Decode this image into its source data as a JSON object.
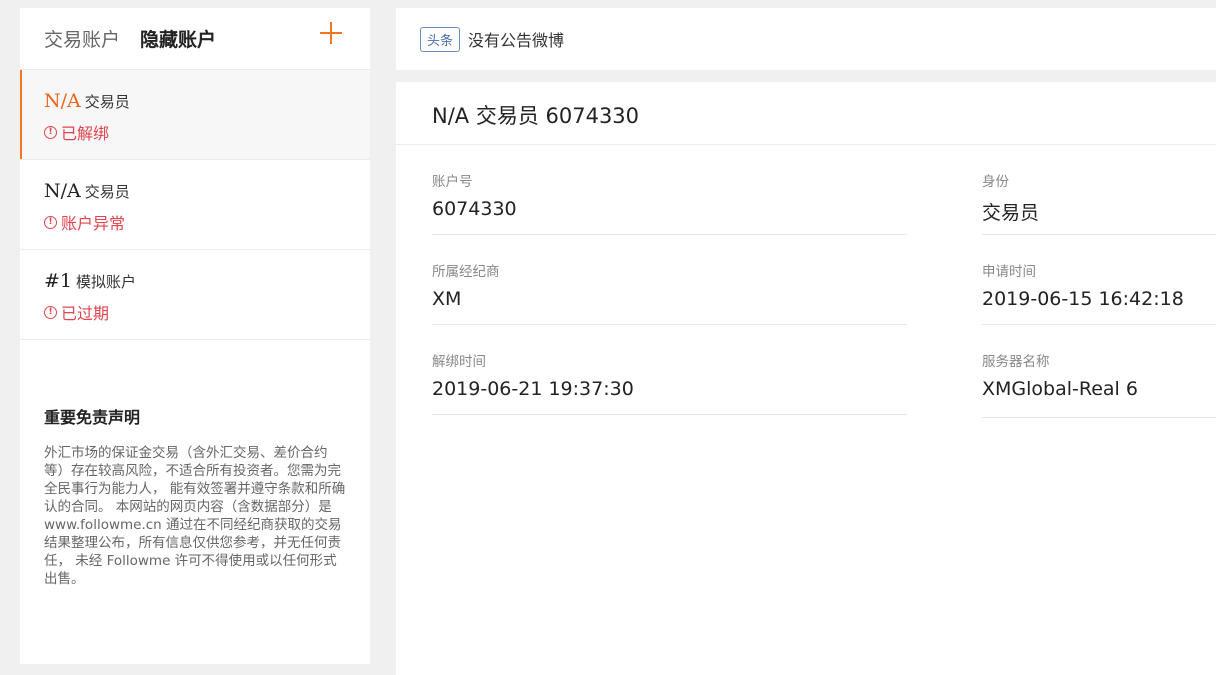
{
  "left_panel": {
    "tabs": [
      {
        "label": "交易账户",
        "active": false
      },
      {
        "label": "隐藏账户",
        "active": true
      }
    ],
    "add_icon": "plus-icon",
    "accounts": [
      {
        "id": "N/A",
        "role": "交易员",
        "status": "已解绑",
        "selected": true
      },
      {
        "id": "N/A",
        "role": "交易员",
        "status": "账户异常",
        "selected": false
      },
      {
        "id": "#1",
        "role": "模拟账户",
        "status": "已过期",
        "selected": false
      }
    ],
    "status_icon": "info-circle-icon",
    "disclaimer": {
      "title": "重要免责声明",
      "text": "外汇市场的保证金交易（含外汇交易、差价合约等）存在较高风险，不适合所有投资者。您需为完全民事行为能力人， 能有效签署并遵守条款和所确认的合同。 本网站的网页内容（含数据部分）是 www.followme.cn 通过在不同经纪商获取的交易结果整理公布，所有信息仅供您参考，并无任何责任， 未经 Followme 许可不得使用或以任何形式出售。"
    }
  },
  "notice": {
    "tag": "头条",
    "text": "没有公告微博"
  },
  "detail": {
    "title": "N/A 交易员 6074330",
    "fields": {
      "account_no": {
        "label": "账户号",
        "value": "6074330"
      },
      "identity": {
        "label": "身份",
        "value": "交易员"
      },
      "broker": {
        "label": "所属经纪商",
        "value": "XM"
      },
      "apply_time": {
        "label": "申请时间",
        "value": "2019-06-15 16:42:18"
      },
      "unbind_time": {
        "label": "解绑时间",
        "value": "2019-06-21 19:37:30"
      },
      "server_name": {
        "label": "服务器名称",
        "value": "XMGlobal-Real 6"
      }
    }
  },
  "colors": {
    "accent": "#f07723",
    "status_red": "#e0454f",
    "tag_blue": "#4a6fae"
  }
}
